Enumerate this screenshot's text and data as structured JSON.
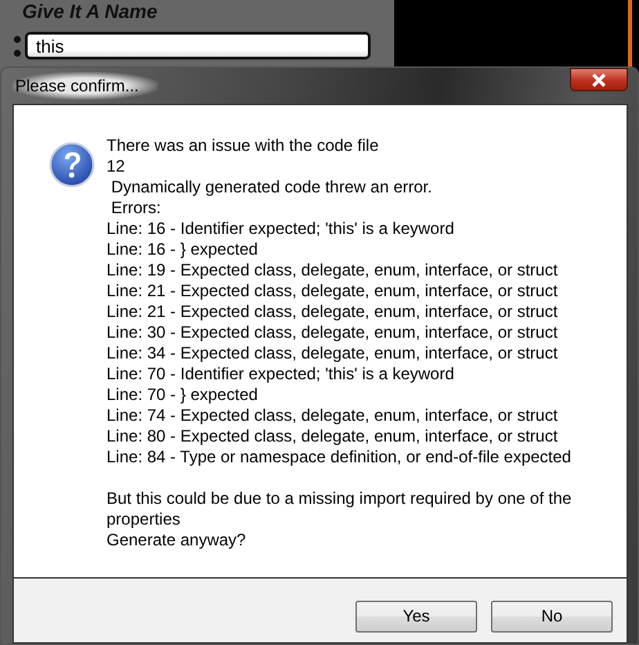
{
  "background": {
    "heading": "Give It A Name",
    "field": {
      "value": "this"
    }
  },
  "dialog": {
    "title": "Please confirm...",
    "message": [
      [
        "There was an issue with the code file",
        "12",
        " Dynamically generated code threw an error.",
        " Errors:",
        "Line: 16 - Identifier expected; 'this' is a keyword",
        "Line: 16 - } expected",
        "Line: 19 - Expected class, delegate, enum, interface, or struct",
        "Line: 21 - Expected class, delegate, enum, interface, or struct",
        "Line: 21 - Expected class, delegate, enum, interface, or struct",
        "Line: 30 - Expected class, delegate, enum, interface, or struct",
        "Line: 34 - Expected class, delegate, enum, interface, or struct",
        "Line: 70 - Identifier expected; 'this' is a keyword",
        "Line: 70 - } expected",
        "Line: 74 - Expected class, delegate, enum, interface, or struct",
        "Line: 80 - Expected class, delegate, enum, interface, or struct",
        "Line: 84 - Type or namespace definition, or end-of-file expected"
      ],
      [
        "But this could be due to a missing import required by one of the properties",
        "Generate anyway?"
      ]
    ],
    "buttons": [
      "Yes",
      "No"
    ]
  }
}
